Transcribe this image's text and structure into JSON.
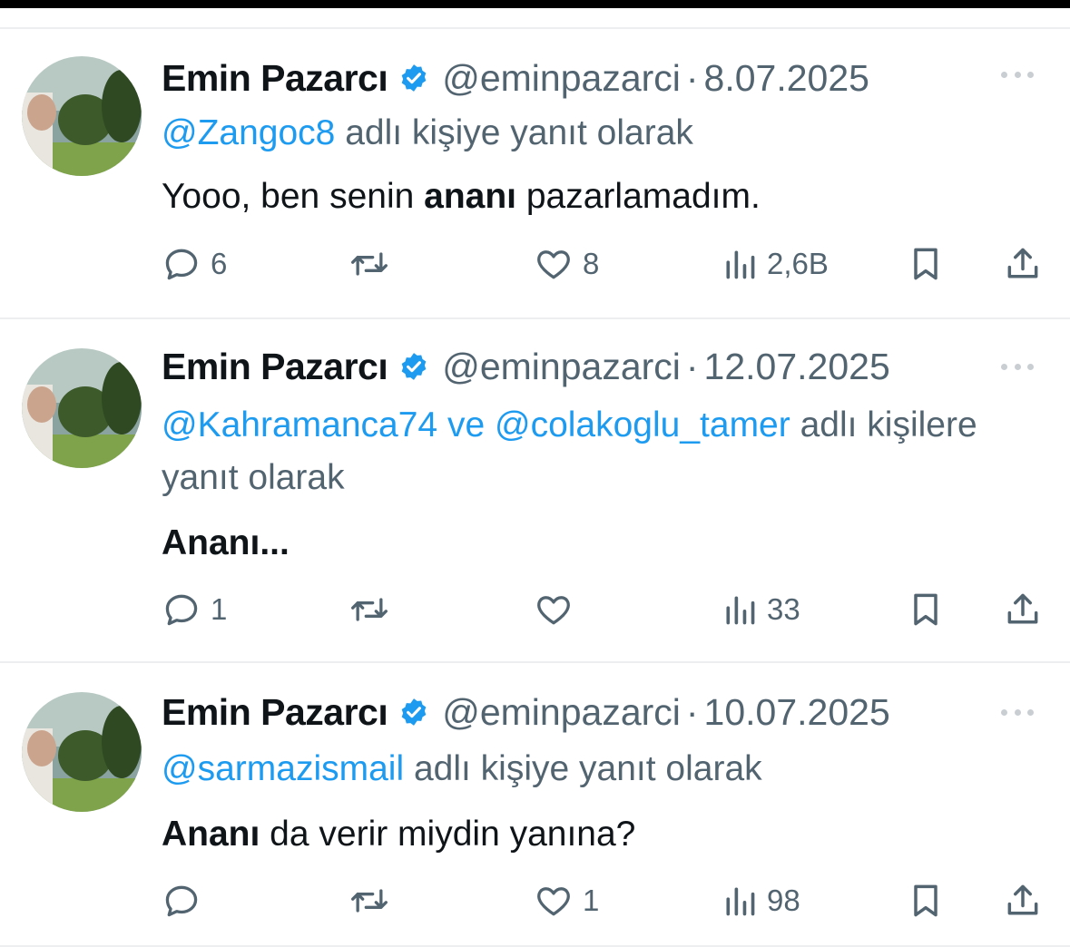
{
  "tweets": [
    {
      "name": "Emin Pazarcı",
      "handle": "@eminpazarci",
      "date": "8.07.2025",
      "reply_mentions": [
        "@Zangoc8"
      ],
      "reply_conjunction": "",
      "reply_suffix": " adlı kişiye yanıt olarak",
      "body_pre": "Yooo, ben senin ",
      "body_bold": "ananı",
      "body_post": " pazarlamadım.",
      "replies": "6",
      "retweets": "",
      "likes": "8",
      "views": "2,6B"
    },
    {
      "name": "Emin Pazarcı",
      "handle": "@eminpazarci",
      "date": "12.07.2025",
      "reply_mentions": [
        "@Kahramanca74",
        "@colakoglu_tamer"
      ],
      "reply_conjunction": " ve ",
      "reply_suffix": " adlı kişilere yanıt olarak",
      "body_pre": "",
      "body_bold": "Ananı...",
      "body_post": "",
      "replies": "1",
      "retweets": "",
      "likes": "",
      "views": "33"
    },
    {
      "name": "Emin Pazarcı",
      "handle": "@eminpazarci",
      "date": "10.07.2025",
      "reply_mentions": [
        "@sarmazismail"
      ],
      "reply_conjunction": "",
      "reply_suffix": " adlı kişiye yanıt olarak",
      "body_pre": "",
      "body_bold": "Ananı",
      "body_post": " da verir miydin yanına?",
      "replies": "",
      "retweets": "",
      "likes": "1",
      "views": "98"
    }
  ],
  "colors": {
    "text": "#0f1419",
    "secondary": "#536471",
    "accent": "#1d9bf0",
    "divider": "#eceef0"
  },
  "icons": [
    "verified-badge-icon",
    "more-icon",
    "reply-icon",
    "retweet-icon",
    "like-icon",
    "views-icon",
    "bookmark-icon",
    "share-icon"
  ]
}
